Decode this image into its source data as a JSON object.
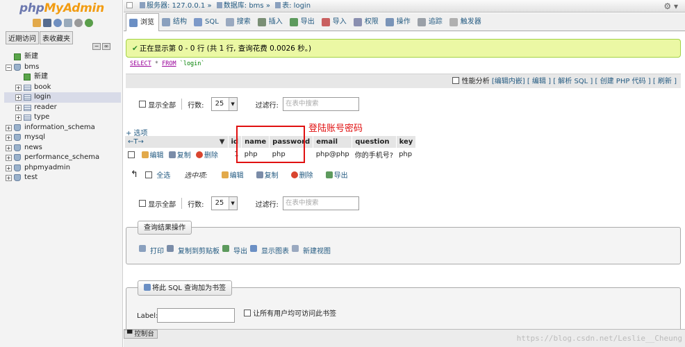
{
  "logo": {
    "php": "php",
    "myadmin": "MyAdmin"
  },
  "left_tabs": [
    "近期访问",
    "表收藏夹"
  ],
  "tree": [
    {
      "label": "新建",
      "level": 0,
      "type": "new",
      "toggle": ""
    },
    {
      "label": "bms",
      "level": 0,
      "type": "db",
      "toggle": "−"
    },
    {
      "label": "新建",
      "level": 1,
      "type": "new",
      "toggle": ""
    },
    {
      "label": "book",
      "level": 1,
      "type": "table",
      "toggle": "+"
    },
    {
      "label": "login",
      "level": 1,
      "type": "table",
      "toggle": "+",
      "selected": true
    },
    {
      "label": "reader",
      "level": 1,
      "type": "table",
      "toggle": "+"
    },
    {
      "label": "type",
      "level": 1,
      "type": "table",
      "toggle": "+"
    },
    {
      "label": "information_schema",
      "level": 0,
      "type": "db",
      "toggle": "+"
    },
    {
      "label": "mysql",
      "level": 0,
      "type": "db",
      "toggle": "+"
    },
    {
      "label": "news",
      "level": 0,
      "type": "db",
      "toggle": "+"
    },
    {
      "label": "performance_schema",
      "level": 0,
      "type": "db",
      "toggle": "+"
    },
    {
      "label": "phpmyadmin",
      "level": 0,
      "type": "db",
      "toggle": "+"
    },
    {
      "label": "test",
      "level": 0,
      "type": "db",
      "toggle": "+"
    }
  ],
  "breadcrumb": {
    "server": "服务器: 127.0.0.1",
    "sep1": "»",
    "database": "数据库: bms",
    "sep2": "»",
    "table": "表: login"
  },
  "tabs": [
    {
      "label": "浏览",
      "color": "#6b8fc4"
    },
    {
      "label": "结构",
      "color": "#8aa0be"
    },
    {
      "label": "SQL",
      "color": "#7d99c8"
    },
    {
      "label": "搜索",
      "color": "#9aa9c0"
    },
    {
      "label": "插入",
      "color": "#7a8f75"
    },
    {
      "label": "导出",
      "color": "#5d9a5d"
    },
    {
      "label": "导入",
      "color": "#c96060"
    },
    {
      "label": "权限",
      "color": "#8a8fb0"
    },
    {
      "label": "操作",
      "color": "#7a94b8"
    },
    {
      "label": "追踪",
      "color": "#9aa0a8"
    },
    {
      "label": "触发器",
      "color": "#b0b0b0"
    }
  ],
  "success_message": "正在显示第 0 - 0 行 (共 1 行, 查询花费 0.0026 秒。)",
  "sql_query": {
    "select": "SELECT",
    "star": "*",
    "from": "FROM",
    "table": "`login`"
  },
  "sql_bar": {
    "profiling": "性能分析",
    "links": [
      "[编辑内嵌]",
      "[ 编辑 ]",
      "[ 解析 SQL ]",
      "[ 创建 PHP 代码 ]",
      "[ 刷新 ]"
    ]
  },
  "nav": {
    "show_all": "显示全部",
    "rows_label": "行数:",
    "rows_value": "25",
    "filter_label": "过滤行:",
    "filter_placeholder": "在表中搜索"
  },
  "options_link": "+ 选项",
  "sort_arrows": "←T→",
  "columns": [
    "id",
    "name",
    "password",
    "email",
    "question",
    "key"
  ],
  "row_actions": {
    "edit": "编辑",
    "copy": "复制",
    "delete": "删除"
  },
  "row": {
    "id": "1",
    "name": "php",
    "password": "php",
    "email": "php@php",
    "question": "你的手机号?",
    "key": "php"
  },
  "annotation": "登陆账号密码",
  "bulk": {
    "check_all": "全选",
    "with_selected": "选中项:",
    "edit": "编辑",
    "copy": "复制",
    "delete": "删除",
    "export": "导出"
  },
  "query_ops": {
    "legend": "查询结果操作",
    "items": [
      "打印",
      "复制到剪贴板",
      "导出",
      "显示图表",
      "新建视图"
    ]
  },
  "bookmark": {
    "legend": "将此 SQL 查询加为书签",
    "label": "Label:",
    "public_checkbox": "让所有用户均可访问此书签"
  },
  "console": "控制台",
  "watermark": "https://blog.csdn.net/Leslie__Cheung"
}
